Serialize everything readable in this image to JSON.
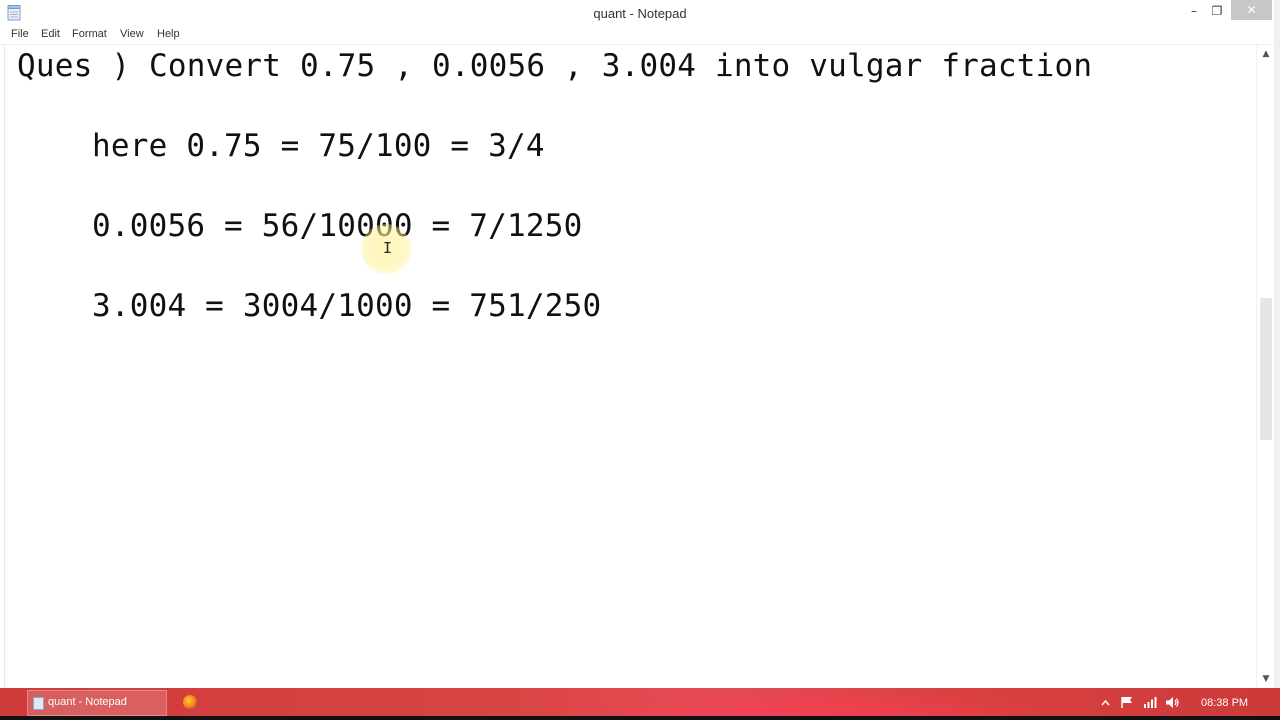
{
  "window": {
    "title": "quant - Notepad"
  },
  "titlebar": {
    "minimize_glyph": "–",
    "maximize_glyph": "❐",
    "close_glyph": "✕"
  },
  "menu": {
    "items": [
      {
        "label": "File"
      },
      {
        "label": "Edit"
      },
      {
        "label": "Format"
      },
      {
        "label": "View"
      },
      {
        "label": "Help"
      }
    ]
  },
  "document": {
    "lines": [
      "Ques ) Convert 0.75 , 0.0056 , 3.004 into vulgar fraction",
      "here 0.75 = 75/100 = 3/4",
      "0.0056 = 56/10000 = 7/1250",
      "3.004 = 3004/1000 = 751/250"
    ]
  },
  "scrollbar": {
    "up_glyph": "▲",
    "down_glyph": "▼"
  },
  "taskbar": {
    "task_label": "quant - Notepad",
    "clock": "08:38 PM",
    "tray_icons": [
      "chevron-up-icon",
      "flag-icon",
      "network-icon",
      "speaker-icon"
    ]
  }
}
